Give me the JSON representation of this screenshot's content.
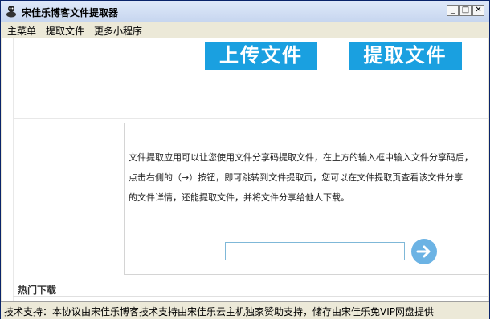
{
  "window": {
    "title": "宋佳乐博客文件提取器"
  },
  "menu": {
    "items": [
      "主菜单",
      "提取文件",
      "更多小程序"
    ]
  },
  "main": {
    "upload_label": "上传文件",
    "extract_label": "提取文件",
    "description_lines": [
      "文件提取应用可以让您使用文件分享码提取文件，在上方的输入框中输入文件分享码后，",
      "点击右侧的（→）按钮，即可跳转到文件提取页，您可以在文件提取页查看该文件分享",
      "的文件详情，还能提取文件，并将文件分享给他人下载。"
    ],
    "share_code_value": "",
    "hot_downloads_label": "热门下载"
  },
  "status": {
    "text": "技术支持：本协议由宋佳乐博客技术支持由宋佳乐云主机独家赞助支持，储存由宋佳乐免VIP网盘提供"
  },
  "colors": {
    "accent": "#1aa0e0",
    "go_button": "#6cb3e4"
  }
}
